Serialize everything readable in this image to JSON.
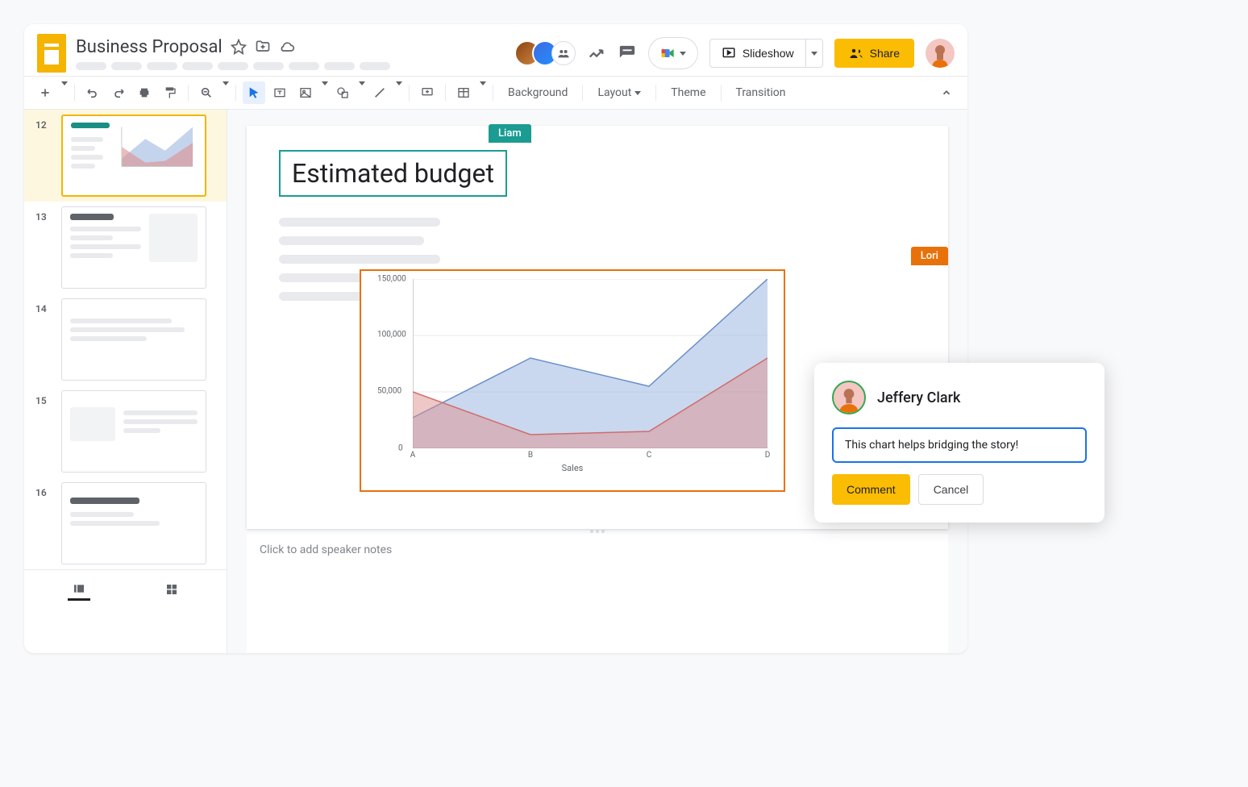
{
  "doc": {
    "title": "Business Proposal"
  },
  "header": {
    "slideshow_label": "Slideshow",
    "share_label": "Share"
  },
  "toolbar": {
    "background": "Background",
    "layout": "Layout",
    "theme": "Theme",
    "transition": "Transition"
  },
  "filmstrip": {
    "slides": [
      {
        "num": "12"
      },
      {
        "num": "13"
      },
      {
        "num": "14"
      },
      {
        "num": "15"
      },
      {
        "num": "16"
      }
    ]
  },
  "canvas": {
    "collab1": "Liam",
    "collab2": "Lori",
    "slide_title": "Estimated budget"
  },
  "chart_data": {
    "type": "area",
    "xlabel": "Sales",
    "ylabel": "",
    "ylim": [
      0,
      150000
    ],
    "y_ticks": [
      "0",
      "50,000",
      "100,000",
      "150,000"
    ],
    "categories": [
      "A",
      "B",
      "C",
      "D"
    ],
    "series": [
      {
        "name": "blue",
        "color": "#9db8e0",
        "values": [
          27000,
          80000,
          55000,
          150000
        ]
      },
      {
        "name": "red",
        "color": "#dd8f8f",
        "values": [
          50000,
          12000,
          15000,
          80000
        ]
      }
    ]
  },
  "speaker_notes": {
    "placeholder": "Click to add speaker notes"
  },
  "comment": {
    "author": "Jeffery Clark",
    "text": "This chart helps bridging the story!",
    "submit_label": "Comment",
    "cancel_label": "Cancel"
  }
}
